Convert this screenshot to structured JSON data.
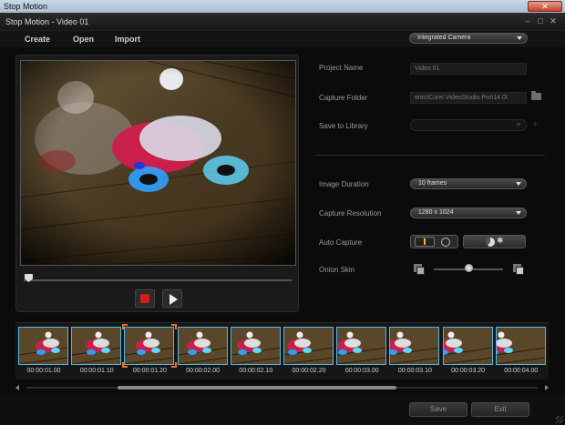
{
  "window": {
    "title": "Stop Motion",
    "close_label": "✕"
  },
  "app": {
    "title": "Stop Motion - Video 01"
  },
  "menu": {
    "create": "Create",
    "open": "Open",
    "import": "Import"
  },
  "camera_select": {
    "value": "Integrated Camera"
  },
  "form": {
    "project_name_label": "Project Name",
    "project_name_value": "Video 01",
    "capture_folder_label": "Capture Folder",
    "capture_folder_value": "ents\\Corel VideoStudio Pro\\14.0\\",
    "save_to_library_label": "Save to Library",
    "image_duration_label": "Image Duration",
    "image_duration_value": "10 frames",
    "capture_resolution_label": "Capture Resolution",
    "capture_resolution_value": "1280 x 1024",
    "auto_capture_label": "Auto Capture",
    "onion_skin_label": "Onion Skin",
    "onion_skin_level": 0.5
  },
  "timeline": {
    "frames": [
      {
        "time": "00:00:01.00"
      },
      {
        "time": "00:00:01.10"
      },
      {
        "time": "00:00:01.20"
      },
      {
        "time": "00:00:02.00"
      },
      {
        "time": "00:00:02.10"
      },
      {
        "time": "00:00:02.20"
      },
      {
        "time": "00:00:03.00"
      },
      {
        "time": "00:00:03.10"
      },
      {
        "time": "00:00:03.20"
      },
      {
        "time": "00:00:04.00"
      }
    ],
    "selected_index": 2
  },
  "buttons": {
    "save": "Save",
    "exit": "Exit"
  },
  "colors": {
    "accent_blue": "#4fb7e8",
    "selection_orange": "#ff6a1a",
    "record_red": "#d81a1a"
  }
}
